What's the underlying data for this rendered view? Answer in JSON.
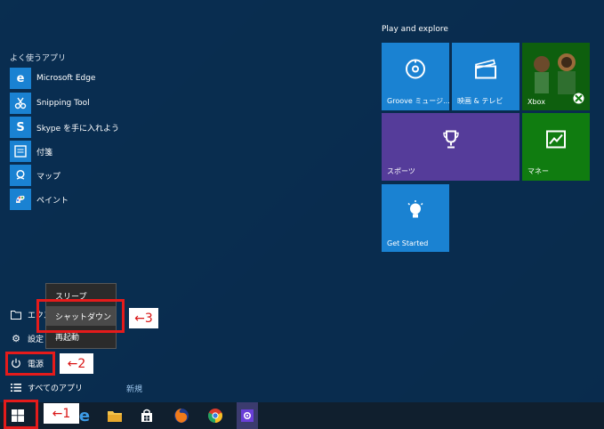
{
  "start_menu": {
    "section_label": "よく使うアプリ",
    "apps": [
      {
        "name": "Microsoft Edge",
        "icon": "edge-icon",
        "color": "#1a82d2"
      },
      {
        "name": "Snipping Tool",
        "icon": "scissors-icon",
        "color": "#1a82d2"
      },
      {
        "name": "Skype を手に入れよう",
        "icon": "skype-icon",
        "color": "#1a82d2"
      },
      {
        "name": "付箋",
        "icon": "sticky-notes-icon",
        "color": "#1a82d2"
      },
      {
        "name": "マップ",
        "icon": "maps-icon",
        "color": "#1a82d2"
      },
      {
        "name": "ペイント",
        "icon": "paint-icon",
        "color": "#1a82d2"
      }
    ],
    "explorer_label": "エクスプローラー",
    "settings_label": "設定",
    "power_label": "電源",
    "all_apps_label": "すべてのアプリ",
    "new_label": "新規",
    "power_menu": {
      "options": [
        "スリープ",
        "シャットダウン",
        "再起動"
      ],
      "selected": "シャットダウン"
    }
  },
  "annotations": {
    "callout_1": "←1",
    "callout_2": "←2",
    "callout_3": "←3",
    "highlight_color": "#e51b1b"
  },
  "tiles": {
    "section_label": "Play and explore",
    "items": [
      {
        "label": "Groove ミュージ...",
        "icon": "groove-music-icon",
        "color": "#1a82d2"
      },
      {
        "label": "映画 & テレビ",
        "icon": "movies-tv-icon",
        "color": "#1a82d2"
      },
      {
        "label": "Xbox",
        "icon": "xbox-icon",
        "color": "#107c10"
      },
      {
        "label": "スポーツ",
        "icon": "trophy-icon",
        "color": "#553c9a"
      },
      {
        "label": "マネー",
        "icon": "money-chart-icon",
        "color": "#107c10"
      },
      {
        "label": "Get Started",
        "icon": "lightbulb-icon",
        "color": "#1a82d2"
      }
    ]
  },
  "taskbar": {
    "items": [
      "start-button",
      "edge",
      "file-explorer",
      "store",
      "firefox",
      "chrome",
      "settings-app"
    ]
  }
}
